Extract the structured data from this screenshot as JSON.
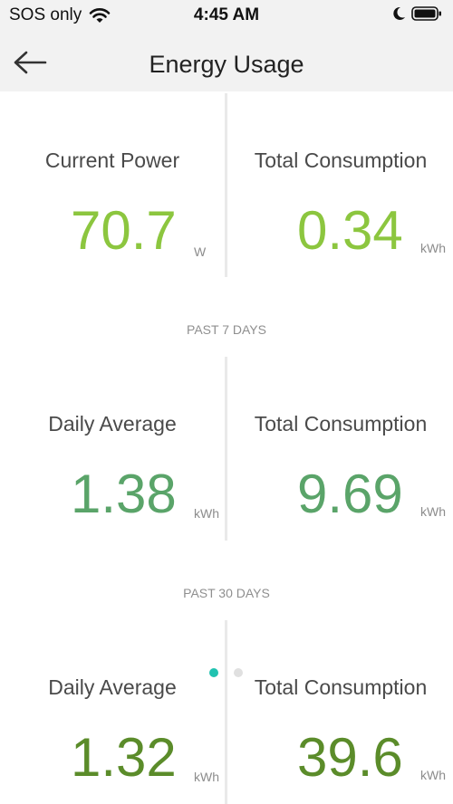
{
  "status_bar": {
    "carrier": "SOS only",
    "time": "4:45 AM"
  },
  "header": {
    "title": "Energy Usage"
  },
  "current": {
    "left": {
      "label": "Current Power",
      "value": "70.7",
      "unit": "W"
    },
    "right": {
      "label": "Total Consumption",
      "value": "0.34",
      "unit": "kWh"
    }
  },
  "past_7_days": {
    "heading": "PAST 7 DAYS",
    "left": {
      "label": "Daily Average",
      "value": "1.38",
      "unit": "kWh"
    },
    "right": {
      "label": "Total Consumption",
      "value": "9.69",
      "unit": "kWh"
    }
  },
  "past_30_days": {
    "heading": "PAST 30 DAYS",
    "left": {
      "label": "Daily Average",
      "value": "1.32",
      "unit": "kWh"
    },
    "right": {
      "label": "Total Consumption",
      "value": "39.6",
      "unit": "kWh"
    }
  },
  "page_indicator": {
    "pages": 2,
    "active": 1
  },
  "colors": {
    "light_green": "#8cc63f",
    "medium_green": "#5aa469",
    "dark_green": "#5b8c2a",
    "active_dot": "#20c2b0",
    "inactive_dot": "#e0e0e0"
  }
}
